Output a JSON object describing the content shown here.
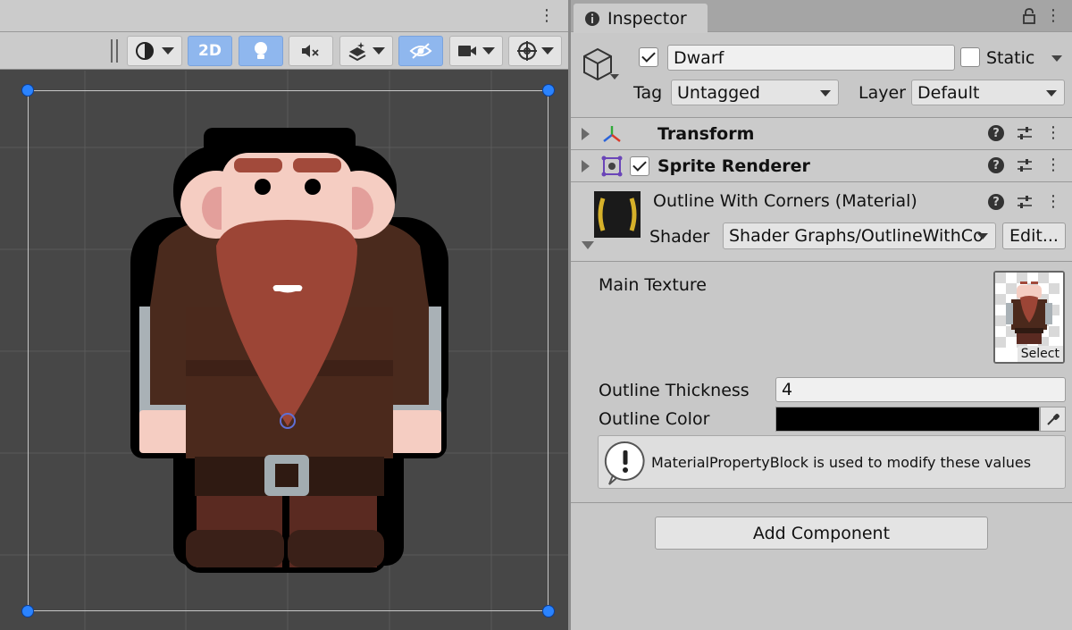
{
  "scene": {
    "toolbar": {
      "mode_2d_label": "2D",
      "icons": [
        "draw-mode-icon",
        "lighting-icon",
        "audio-mute-icon",
        "effects-icon",
        "hidden-objects-icon",
        "camera-icon",
        "gizmos-icon"
      ]
    }
  },
  "inspector": {
    "tab_label": "Inspector",
    "object": {
      "name": "Dwarf",
      "active": true,
      "static_label": "Static",
      "static_checked": false,
      "tag_label": "Tag",
      "tag_value": "Untagged",
      "layer_label": "Layer",
      "layer_value": "Default"
    },
    "components": {
      "transform": {
        "title": "Transform"
      },
      "sprite_renderer": {
        "title": "Sprite Renderer",
        "enabled": true
      }
    },
    "material": {
      "title": "Outline With Corners (Material)",
      "shader_label": "Shader",
      "shader_value": "Shader Graphs/OutlineWithCo",
      "edit_label": "Edit...",
      "main_texture_label": "Main Texture",
      "select_label": "Select",
      "outline_thickness_label": "Outline Thickness",
      "outline_thickness_value": "4",
      "outline_color_label": "Outline Color",
      "outline_color_value": "#000000",
      "info_message": "MaterialPropertyBlock is used to modify these values"
    },
    "add_component_label": "Add Component"
  },
  "colors": {
    "accent_blue": "#8fb7ee",
    "handle_blue": "#2a83ff",
    "scene_bg": "#474747",
    "panel_bg": "#c8c8c8"
  }
}
